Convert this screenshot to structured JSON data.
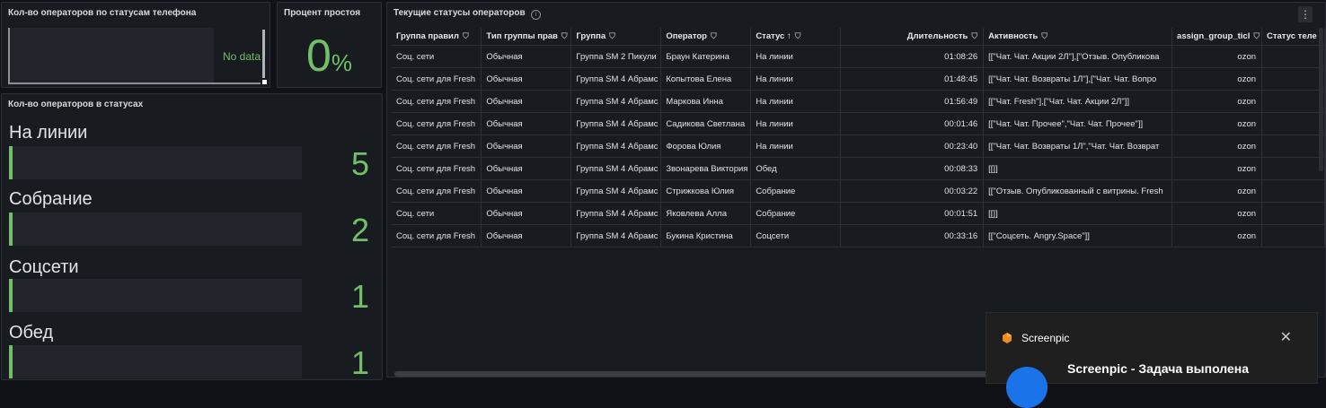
{
  "panel_phone": {
    "title": "Кол-во операторов по статусам телефона",
    "no_data": "No data"
  },
  "panel_idle": {
    "title": "Процент простоя",
    "value": "0",
    "unit": "%"
  },
  "panel_counts": {
    "title": "Кол-во операторов в статусах",
    "items": [
      {
        "label": "На линии",
        "value": "5"
      },
      {
        "label": "Собрание",
        "value": "2"
      },
      {
        "label": "Соцсети",
        "value": "1"
      },
      {
        "label": "Обед",
        "value": "1"
      }
    ]
  },
  "panel_table": {
    "title": "Текущие статусы операторов",
    "columns": [
      "Группа правил",
      "Тип группы прав",
      "Группа",
      "Оператор",
      "Статус",
      "Длительность",
      "Активность",
      "assign_group_ticl",
      "Статус теле"
    ],
    "sort_arrow": "↑",
    "rows": [
      [
        "Соц. сети",
        "Обычная",
        "Группа SM 2 Пикули",
        "Браун Катерина",
        "На линии",
        "01:08:26",
        "[[\"Чат. Чат. Акции 2Л\"],[\"Отзыв. Опубликова",
        "ozon",
        ""
      ],
      [
        "Соц. сети для Fresh",
        "Обычная",
        "Группа SM 4 Абрамс",
        "Копытова Елена",
        "На линии",
        "01:48:45",
        "[[\"Чат. Чат. Возвраты 1Л\"],[\"Чат. Чат. Вопро",
        "ozon",
        ""
      ],
      [
        "Соц. сети для Fresh",
        "Обычная",
        "Группа SM 4 Абрамс",
        "Маркова Инна",
        "На линии",
        "01:56:49",
        "[[\"Чат. Fresh\"],[\"Чат. Чат. Акции 2Л\"]]",
        "ozon",
        ""
      ],
      [
        "Соц. сети для Fresh",
        "Обычная",
        "Группа SM 4 Абрамс",
        "Садикова Светлана",
        "На линии",
        "00:01:46",
        "[[\"Чат. Чат. Прочее\",\"Чат. Чат. Прочее\"]]",
        "ozon",
        ""
      ],
      [
        "Соц. сети для Fresh",
        "Обычная",
        "Группа SM 4 Абрамс",
        "Форова Юлия",
        "На линии",
        "00:23:40",
        "[[\"Чат. Чат. Возвраты 1Л\",\"Чат. Чат. Возврат",
        "ozon",
        ""
      ],
      [
        "Соц. сети для Fresh",
        "Обычная",
        "Группа SM 4 Абрамс",
        "Звонарева Виктория",
        "Обед",
        "00:08:33",
        "[[]]",
        "ozon",
        ""
      ],
      [
        "Соц. сети для Fresh",
        "Обычная",
        "Группа SM 4 Абрамс",
        "Стрижкова Юлия",
        "Собрание",
        "00:03:22",
        "[[\"Отзыв. Опубликованный с витрины. Fresh",
        "ozon",
        ""
      ],
      [
        "Соц. сети",
        "Обычная",
        "Группа SM 4 Абрамс",
        "Яковлева Алла",
        "Собрание",
        "00:01:51",
        "[[]]",
        "ozon",
        ""
      ],
      [
        "Соц. сети для Fresh",
        "Обычная",
        "Группа SM 4 Абрамс",
        "Букина Кристина",
        "Соцсети",
        "00:33:16",
        "[[\"Соцсеть. Angry.Space\"]]",
        "ozon",
        ""
      ]
    ]
  },
  "toast": {
    "app_name": "Screenpic",
    "message": "Screenpic - Задача выполена",
    "close": "✕"
  },
  "icons": {
    "filter": "filter-icon",
    "info": "info-icon",
    "menu": "menu-icon",
    "close": "close-icon"
  },
  "colors": {
    "accent_green": "#73bf69",
    "background": "#111217",
    "panel": "#181b1f"
  }
}
